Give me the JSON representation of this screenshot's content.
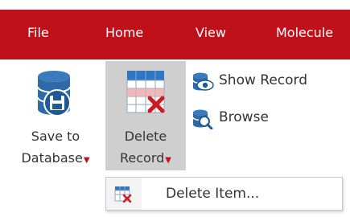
{
  "tabs": [
    {
      "label": "File"
    },
    {
      "label": "Home"
    },
    {
      "label": "View"
    },
    {
      "label": "Molecule"
    }
  ],
  "ribbon": {
    "save": {
      "line1": "Save to",
      "line2": "Database",
      "icon": "database-save-icon"
    },
    "delete": {
      "line1": "Delete",
      "line2": "Record",
      "icon": "table-delete-icon"
    },
    "show_record": {
      "label": "Show Record",
      "icon": "database-eye-icon"
    },
    "browse": {
      "label": "Browse",
      "icon": "database-search-icon"
    }
  },
  "menu": {
    "items": [
      {
        "label": "Delete Item...",
        "icon": "item-delete-icon"
      }
    ]
  },
  "colors": {
    "tab_bar": "#c0101a",
    "selected_button": "#cfcfcf",
    "delete_red": "#cc1a22",
    "db_blue": "#2e6aa8"
  }
}
